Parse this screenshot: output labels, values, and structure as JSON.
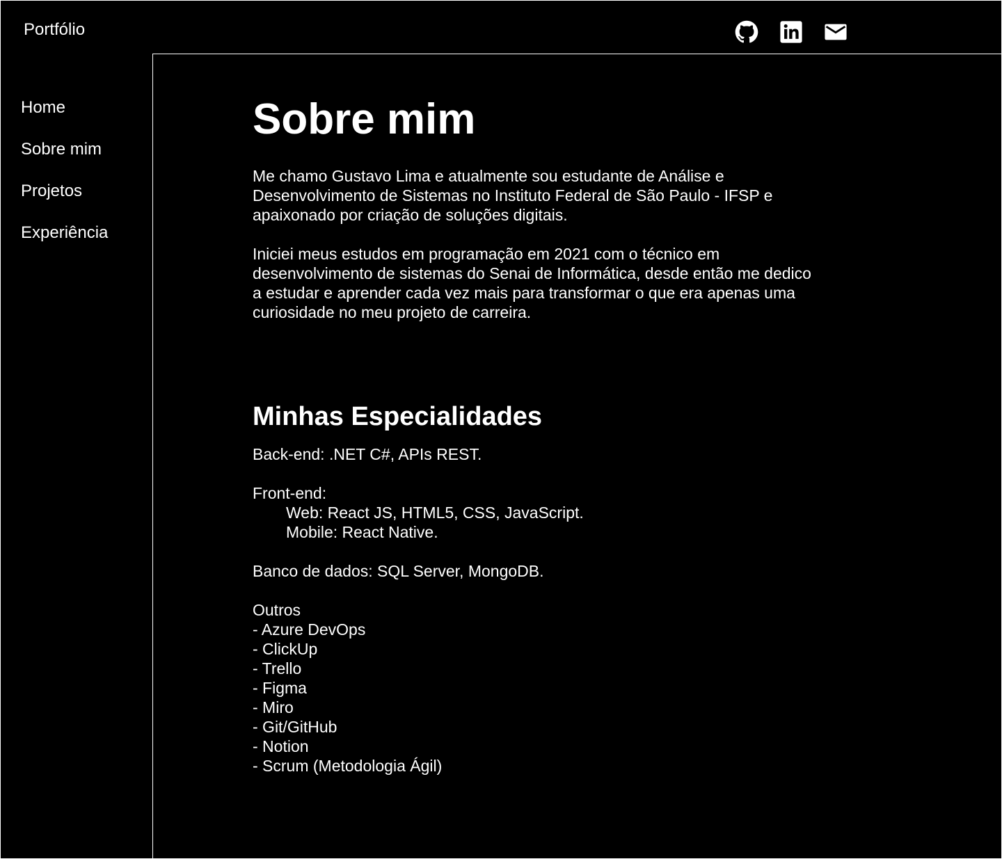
{
  "header": {
    "brand": "Portfólio",
    "social": [
      {
        "icon": "github-icon"
      },
      {
        "icon": "linkedin-icon"
      },
      {
        "icon": "mail-icon"
      }
    ]
  },
  "sidebar": {
    "items": [
      {
        "label": "Home"
      },
      {
        "label": "Sobre mim"
      },
      {
        "label": "Projetos"
      },
      {
        "label": "Experiência"
      }
    ]
  },
  "main": {
    "title": "Sobre mim",
    "paragraphs": [
      "Me chamo Gustavo Lima e atualmente sou estudante de Análise e Desenvolvimento de Sistemas no Instituto Federal de São Paulo - IFSP e apaixonado por criação de soluções digitais.",
      "Iniciei meus estudos em programação em 2021 com o técnico em desenvolvimento de sistemas do Senai de Informática, desde então me dedico a estudar e aprender cada vez mais para transformar o que era apenas uma curiosidade no meu projeto de carreira."
    ],
    "specialties_title": "Minhas Especialidades",
    "backend": "Back-end: .NET C#, APIs REST.",
    "frontend": "Front-end:",
    "frontend_web": "Web: React JS, HTML5, CSS, JavaScript.",
    "frontend_mobile": "Mobile: React Native.",
    "database": "Banco de dados: SQL Server, MongoDB.",
    "others_title": "Outros",
    "others": [
      "- Azure DevOps",
      "- ClickUp",
      "- Trello",
      "- Figma",
      "- Miro",
      "- Git/GitHub",
      "- Notion",
      "- Scrum (Metodologia Ágil)"
    ]
  }
}
